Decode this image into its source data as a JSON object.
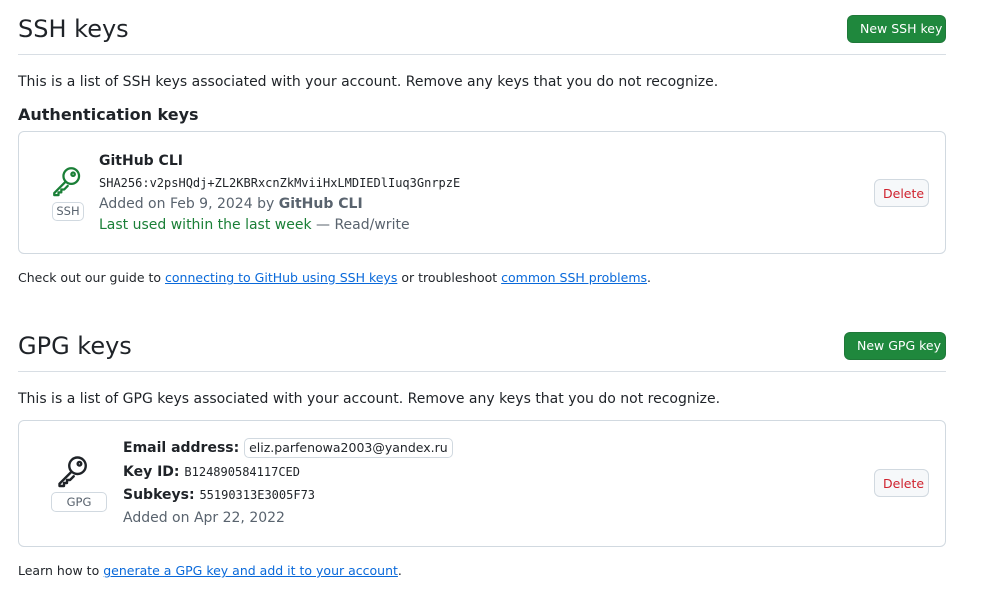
{
  "ssh": {
    "title": "SSH keys",
    "new_button": "New SSH key",
    "description": "This is a list of SSH keys associated with your account. Remove any keys that you do not recognize.",
    "auth_heading": "Authentication keys",
    "key": {
      "badge": "SSH",
      "name": "GitHub CLI",
      "fingerprint": "SHA256:v2psHQdj+ZL2KBRxcnZkMviiHxLMDIEDlIuq3GnrpzE",
      "added_prefix": "Added on Feb 9, 2024 by",
      "added_by": "GitHub CLI",
      "last_used": "Last used within the last week",
      "access": " — Read/write",
      "delete_label": "Delete"
    },
    "guide": {
      "prefix": "Check out our guide to ",
      "link1": "connecting to GitHub using SSH keys",
      "middle": " or troubleshoot ",
      "link2": "common SSH problems",
      "suffix": "."
    }
  },
  "gpg": {
    "title": "GPG keys",
    "new_button": "New GPG key",
    "description": "This is a list of GPG keys associated with your account. Remove any keys that you do not recognize.",
    "key": {
      "badge": "GPG",
      "email_label": "Email address:",
      "email": "eliz.parfenowa2003@yandex.ru",
      "keyid_label": "Key ID:",
      "keyid": "B124890584117CED",
      "subkeys_label": "Subkeys:",
      "subkeys": "55190313E3005F73",
      "added": "Added on Apr 22, 2022",
      "delete_label": "Delete"
    },
    "learn": {
      "prefix": "Learn how to ",
      "link": "generate a GPG key and add it to your account",
      "suffix": "."
    }
  },
  "colors": {
    "primary_green": "#1f883d",
    "danger_red": "#cf222e",
    "link_blue": "#0969da",
    "success_green": "#1a7f37",
    "border": "#d1d9e0"
  }
}
